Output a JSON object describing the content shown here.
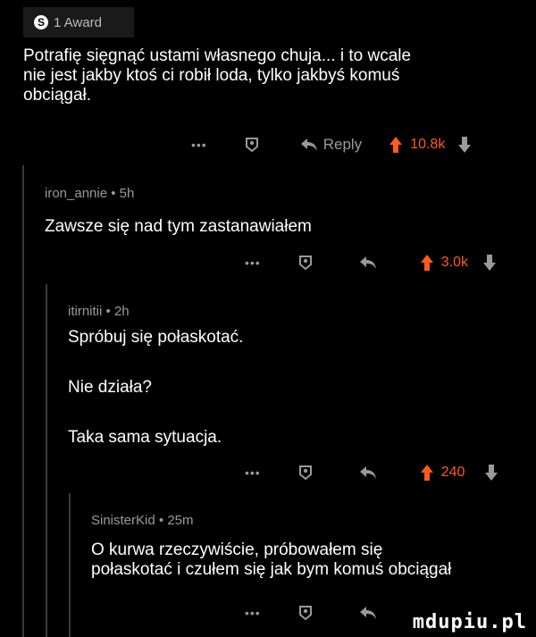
{
  "award": {
    "badge": "S",
    "label": "1 Award"
  },
  "comments": [
    {
      "body": "Potrafię sięgnąć ustami własnego chuja... i to wcale\nnie jest jakby ktoś ci robił loda, tylko jakbyś komuś\nobciągał.",
      "reply_label": "Reply",
      "score": "10.8k"
    },
    {
      "author": "iron_annie",
      "time": "5h",
      "body": "Zawsze się nad tym zastanawiałem",
      "score": "3.0k"
    },
    {
      "author": "itirnitii",
      "time": "2h",
      "body_lines": [
        "Spróbuj się połaskotać.",
        "Nie działa?",
        "Taka sama sytuacja."
      ],
      "score": "240"
    },
    {
      "author": "SinisterKid",
      "time": "25m",
      "body": "O kurwa rzeczywiście, próbowałem się\npołaskotać i czułem się jak bym komuś obciągał"
    }
  ],
  "meta_separator": "•",
  "dots": "•••",
  "watermark": "mdupiu.pl",
  "colors": {
    "upvote": "#ff5a1f",
    "muted": "#9a9a9a",
    "thread_line": "#3a3a3a"
  }
}
